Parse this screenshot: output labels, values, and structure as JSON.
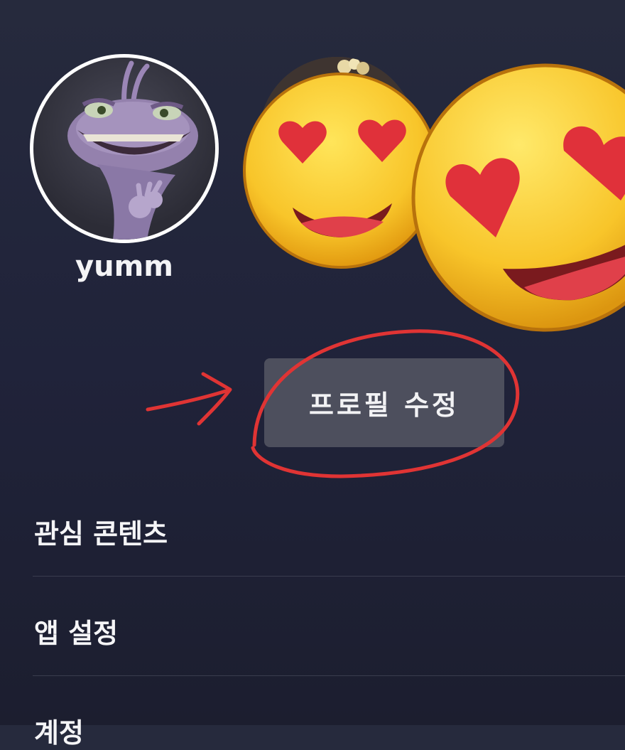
{
  "profiles": [
    {
      "name": "yumm",
      "avatar": "monster-avatar",
      "selected": true
    },
    {
      "name": "",
      "avatar": "popcorn-avatar",
      "selected": false
    }
  ],
  "stickers": [
    "heart-eyes-emoji-icon",
    "heart-eyes-emoji-icon"
  ],
  "edit_profile": {
    "label": "프로필 수정"
  },
  "annotation": {
    "color": "#e03434",
    "marks": [
      "arrow",
      "circle"
    ]
  },
  "menu": {
    "items": [
      {
        "label": "관심 콘텐츠"
      },
      {
        "label": "앱 설정"
      },
      {
        "label": "계정"
      }
    ]
  },
  "colors": {
    "background": "#22253a",
    "button": "#4d4f5d",
    "divider": "#3a3d4e",
    "text": "#f5f5f7"
  }
}
